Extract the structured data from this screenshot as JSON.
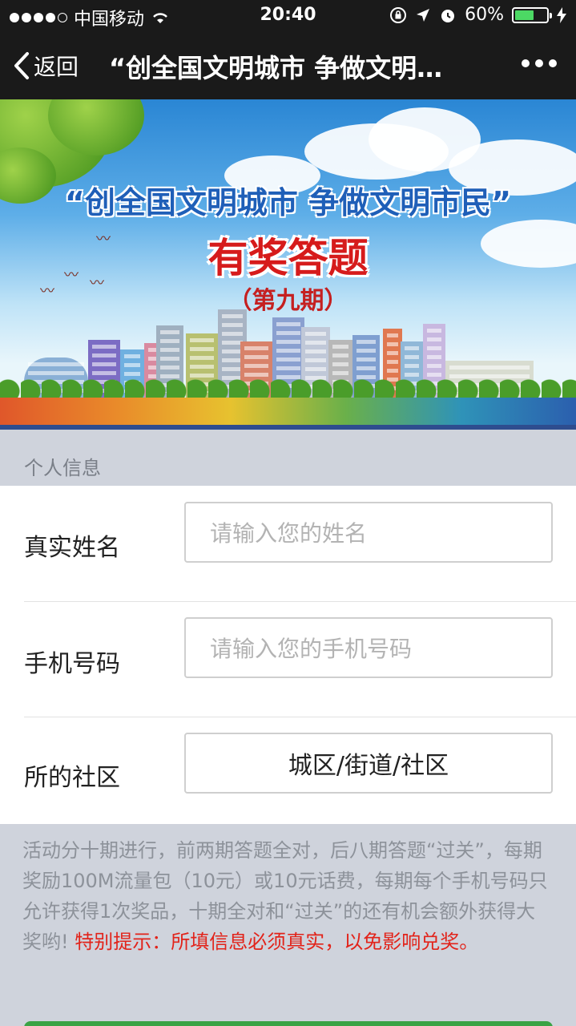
{
  "status_bar": {
    "carrier": "中国移动",
    "time": "20:40",
    "battery_percent": "60%",
    "battery_level": 0.6
  },
  "nav": {
    "back_label": "返回",
    "title": "“创全国文明城市 争做文明…",
    "more_icon": "more-dots-icon"
  },
  "banner": {
    "title": "“创全国文明城市 争做文明市民”",
    "subtitle": "有奖答题",
    "issue": "（第九期）"
  },
  "section": {
    "title": "个人信息"
  },
  "form": {
    "name": {
      "label": "真实姓名",
      "placeholder": "请输入您的姓名"
    },
    "phone": {
      "label": "手机号码",
      "placeholder": "请输入您的手机号码"
    },
    "community": {
      "label": "所的社区",
      "value": "城区/街道/社区"
    }
  },
  "note": {
    "text": "活动分十期进行，前两期答题全对，后八期答题“过关”，每期奖励100M流量包（10元）或10元话费，每期每个手机号码只允许获得1次奖品，十期全对和“过关”的还有机会额外获得大奖哟! ",
    "warning": "特别提示：所填信息必须真实，以免影响兑奖。"
  },
  "colors": {
    "nav_bg": "#1a1a1a",
    "page_bg": "#cfd3dc",
    "warning": "#e2231a",
    "submit_button": "#3aa345"
  }
}
